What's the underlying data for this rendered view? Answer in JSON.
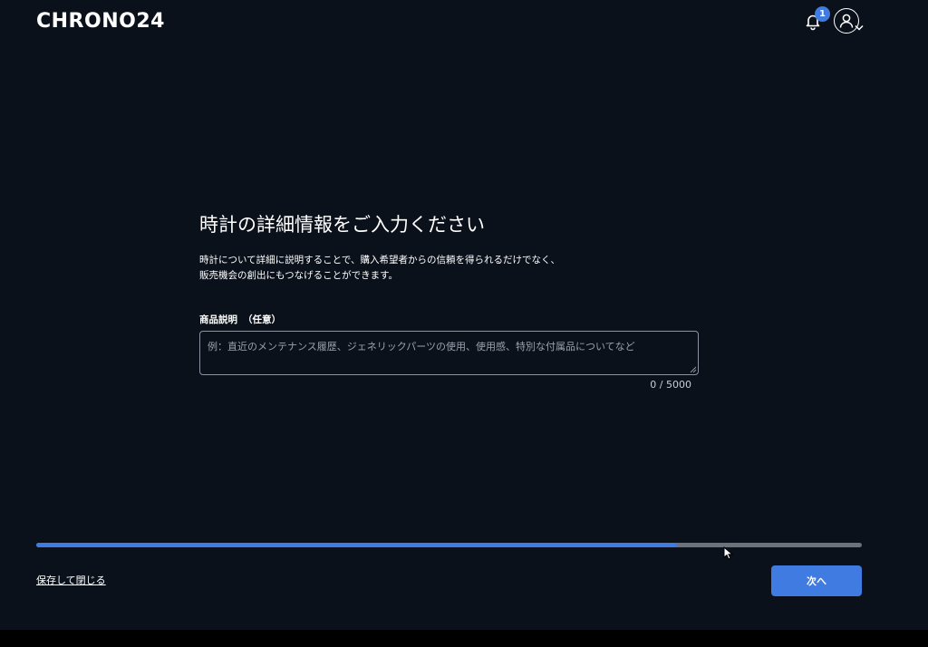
{
  "header": {
    "logo_text": "CHRONO24",
    "notifications_badge": "1",
    "bell_icon": "bell-icon",
    "account_icon": "user-circle-icon",
    "account_chevron_icon": "chevron-down-icon"
  },
  "main": {
    "title": "時計の詳細情報をご入力ください",
    "description_line1": "時計について詳細に説明することで、購入希望者からの信頼を得られるだけでなく、",
    "description_line2": "販売機会の創出にもつなげることができます。",
    "field": {
      "label": "商品説明",
      "optional": "（任意）",
      "value": "",
      "placeholder": "例：直近のメンテナンス履歴、ジェネリックパーツの使用、使用感、特別な付属品についてなど",
      "char_count": "0 / 5000"
    }
  },
  "progress": {
    "value_percent": 77.6
  },
  "footer": {
    "save_close_label": "保存して閉じる",
    "next_label": "次へ"
  },
  "colors": {
    "background": "#0b111b",
    "accent": "#3f7be0",
    "track": "#6c717a"
  }
}
